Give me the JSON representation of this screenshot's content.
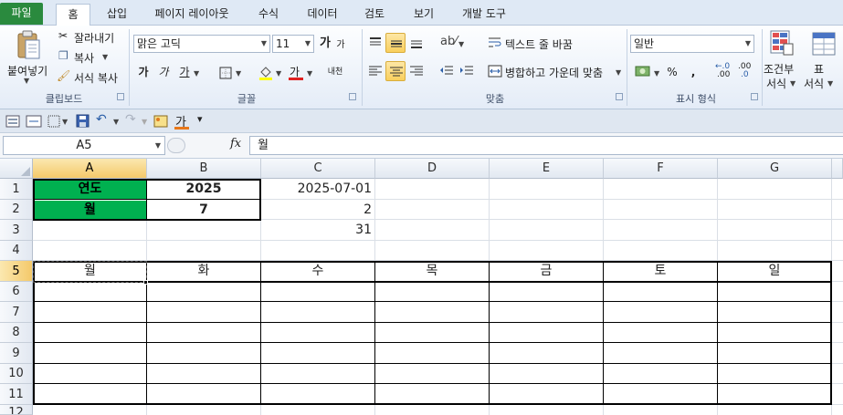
{
  "tabs": [
    {
      "label": "파일"
    },
    {
      "label": "홈"
    },
    {
      "label": "삽입"
    },
    {
      "label": "페이지 레이아웃"
    },
    {
      "label": "수식"
    },
    {
      "label": "데이터"
    },
    {
      "label": "검토"
    },
    {
      "label": "보기"
    },
    {
      "label": "개발 도구"
    }
  ],
  "ribbon": {
    "clipboard": {
      "paste": "붙여넣기",
      "cut": "잘라내기",
      "copy": "복사",
      "format_painter": "서식 복사",
      "label": "클립보드"
    },
    "font": {
      "name": "맑은 고딕",
      "size": "11",
      "grow": "가",
      "shrink": "가",
      "bold": "가",
      "italic": "가",
      "underline": "가",
      "font_color": "가",
      "phonetic": "내천",
      "label": "글꼴"
    },
    "alignment": {
      "wrap_text": "텍스트 줄 바꿈",
      "merge_center": "병합하고 가운데 맞춤",
      "label": "맞춤"
    },
    "number": {
      "format": "일반",
      "percent": "%",
      "comma": ",",
      "inc_decimal": ".00",
      "dec_decimal": ".0",
      "label": "표시 형식"
    },
    "styles": {
      "conditional_1": "조건부",
      "conditional_2": "서식",
      "table_1": "표",
      "table_2": "서식"
    }
  },
  "qat": {
    "font_color": "가"
  },
  "formula_bar": {
    "name_box": "A5",
    "fx": "fx",
    "content": "월"
  },
  "grid": {
    "columns": [
      "A",
      "B",
      "C",
      "D",
      "E",
      "F",
      "G"
    ],
    "rows": [
      "1",
      "2",
      "3",
      "4",
      "5",
      "6",
      "7",
      "8",
      "9",
      "10",
      "11",
      "12"
    ],
    "a1": "연도",
    "b1": "2025",
    "c1": "2025-07-01",
    "a2": "월",
    "b2": "7",
    "c2": "2",
    "c3": "31",
    "weekdays": [
      "월",
      "화",
      "수",
      "목",
      "금",
      "토",
      "일"
    ]
  },
  "colors": {
    "header_green": "#00b050",
    "file_tab": "#2a8a3e",
    "selection": "#f4c96a"
  }
}
